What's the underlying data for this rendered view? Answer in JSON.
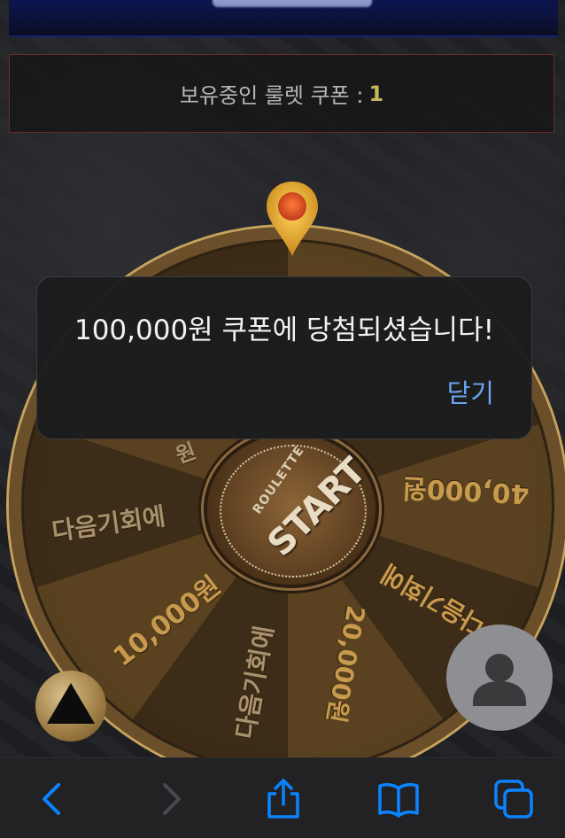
{
  "coupon": {
    "label": "보유중인 룰렛 쿠폰 :",
    "count": "1"
  },
  "wheel": {
    "center_small": "ROULETTE",
    "center_big": "START",
    "segments": [
      "40,000원",
      "다음기회에",
      "20,000원",
      "다음기회에",
      "10,000원",
      "다음기회에",
      "원"
    ]
  },
  "dialog": {
    "message": "100,000원 쿠폰에 당첨되셨습니다!",
    "close_label": "닫기"
  },
  "toolbar": {
    "icons": [
      "back-icon",
      "forward-icon",
      "share-icon",
      "bookmarks-icon",
      "tabs-icon"
    ]
  },
  "colors": {
    "accent_blue": "#0a84ff",
    "coupon_count": "#c4b85a",
    "wheel_gold": "#c79a4d"
  }
}
